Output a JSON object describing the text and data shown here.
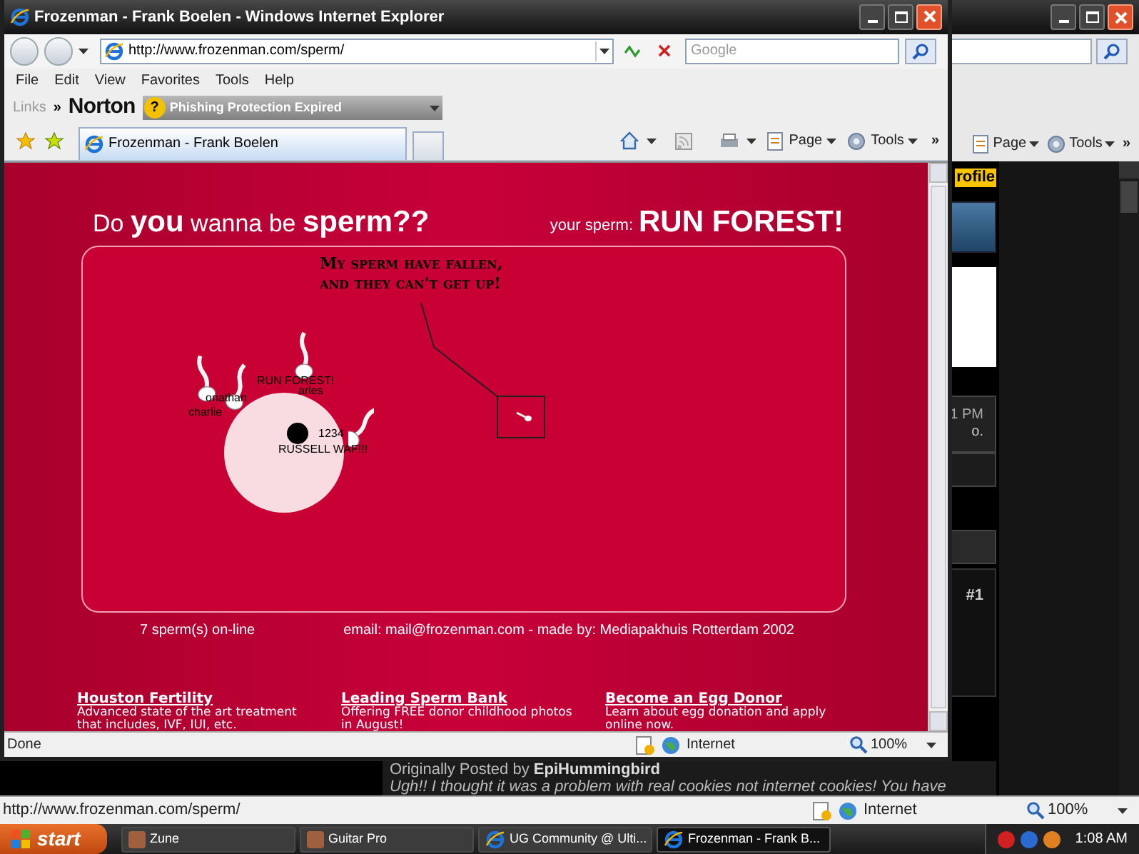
{
  "background_window": {
    "toolbar": [
      "Page",
      "Tools"
    ],
    "toolbar_chevron": "»",
    "profile_button": "rofile",
    "time_fragment": "1 PM",
    "text_fragment": "o.",
    "post_number": "#1",
    "post_author": "Originally Posted by **EpiHummingbird**",
    "post_text": "Ugh!! I thought it was a problem with real cookies not internet cookies! You have",
    "status_url": "http://www.frozenman.com/sperm/",
    "zone": "Internet",
    "zoom": "100%"
  },
  "window": {
    "title": "Frozenman - Frank Boelen - Windows Internet Explorer",
    "address": "http://www.frozenman.com/sperm/",
    "search_placeholder": "Google",
    "menu": [
      "File",
      "Edit",
      "View",
      "Favorites",
      "Tools",
      "Help"
    ],
    "links_label": "Links",
    "links_chevron": "»",
    "norton_logo": "Norton",
    "norton_alert_icon": "?",
    "norton_alert": "Phishing Protection Expired",
    "tabs": [
      {
        "label": "Frozenman - Frank Boelen",
        "selected": true
      }
    ],
    "toolbar": [
      "Page",
      "Tools"
    ],
    "toolbar_chevron": "»"
  },
  "page": {
    "headline": "Do **you** wanna be **sperm??**",
    "your_sperm_label": "your sperm:",
    "your_sperm_name": "RUN FOREST!",
    "speech": [
      "My sperm have fallen,",
      "and they can't get up!"
    ],
    "sperms": [
      {
        "label": "RUN FOREST!"
      },
      {
        "label": "arles"
      },
      {
        "label": "onathan"
      },
      {
        "label": "charlie"
      },
      {
        "label": "1234"
      },
      {
        "label": "RUSSELL WAF!!!"
      }
    ],
    "online": "7 sperm(s) on-line",
    "credits": "email: mail@frozenman.com - made by: Mediapakhuis Rotterdam 2002",
    "ads": [
      {
        "title": "Houston Fertility",
        "text": "Advanced state of the art treatment that includes, IVF, IUI, etc."
      },
      {
        "title": "Leading Sperm Bank",
        "text": "Offering FREE donor childhood photos in August!"
      },
      {
        "title": "Become an Egg Donor",
        "text": "Learn about egg donation and apply online now."
      }
    ]
  },
  "status_bar": {
    "text": "Done",
    "zone": "Internet",
    "zoom": "100%"
  },
  "taskbar": {
    "start": "start",
    "items": [
      {
        "label": "Zune",
        "selected": false
      },
      {
        "label": "Guitar Pro",
        "selected": false
      },
      {
        "label": "UG Community @ Ulti...",
        "selected": false
      },
      {
        "label": "Frozenman - Frank B...",
        "selected": true
      }
    ],
    "clock": "1:08 AM"
  }
}
